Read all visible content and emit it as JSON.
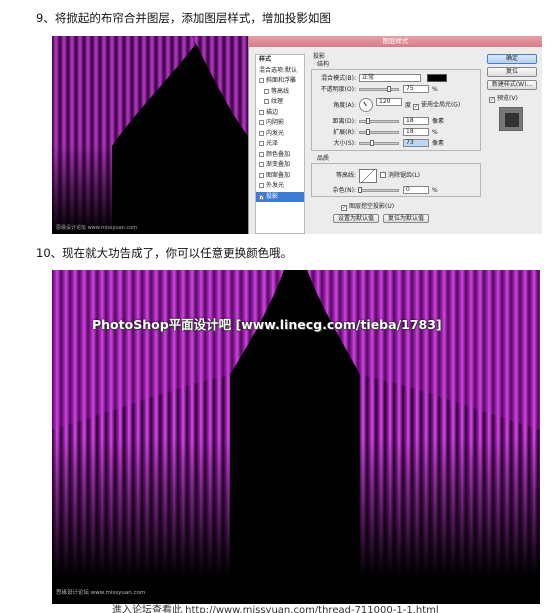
{
  "step9": {
    "text": "9、将掀起的布帘合并图层，添加图层样式，增加投影如图"
  },
  "step10": {
    "text": "10、现在就大功告成了，你可以任意更换颜色哦。"
  },
  "dialog": {
    "title": "图层样式",
    "styles_header": "样式",
    "blend_default": "混合选项:默认",
    "items": [
      {
        "label": "斜面和浮雕",
        "checked": false,
        "sub": false
      },
      {
        "label": "等高线",
        "checked": false,
        "sub": true
      },
      {
        "label": "纹理",
        "checked": false,
        "sub": true
      },
      {
        "label": "描边",
        "checked": false,
        "sub": false
      },
      {
        "label": "内阴影",
        "checked": false,
        "sub": false
      },
      {
        "label": "内发光",
        "checked": false,
        "sub": false
      },
      {
        "label": "光泽",
        "checked": false,
        "sub": false
      },
      {
        "label": "颜色叠加",
        "checked": false,
        "sub": false
      },
      {
        "label": "渐变叠加",
        "checked": false,
        "sub": false
      },
      {
        "label": "图案叠加",
        "checked": false,
        "sub": false
      },
      {
        "label": "外发光",
        "checked": false,
        "sub": false
      },
      {
        "label": "投影",
        "checked": true,
        "sub": false,
        "selected": true
      }
    ],
    "section_title": "投影",
    "structure_title": "结构",
    "blend_mode_label": "混合模式(B):",
    "blend_mode_value": "正常",
    "opacity_label": "不透明度(O):",
    "opacity_value": "75",
    "opacity_pct": 75,
    "angle_label": "角度(A):",
    "angle_value": "120",
    "angle_unit": "度",
    "global_light_label": "使用全局光(G)",
    "distance_label": "距离(D):",
    "distance_value": "18",
    "spread_label": "扩展(R):",
    "spread_value": "18",
    "size_label": "大小(S):",
    "size_value": "73",
    "unit_px": "像素",
    "unit_pct": "%",
    "quality_title": "品质",
    "contour_label": "等高线:",
    "antialias_label": "消除锯齿(L)",
    "noise_label": "杂色(N):",
    "noise_value": "0",
    "knockout_label": "图层挖空投影(U)",
    "set_default": "设置为默认值",
    "reset_default": "复位为默认值",
    "ok": "确定",
    "cancel": "复位",
    "new_style": "新建样式(W)...",
    "preview": "预览(V)"
  },
  "watermark_small": "思缘设计论坛 www.missyuan.com",
  "watermark_big": "PhotoShop平面设计吧 [www.linecg.com/tieba/1783]",
  "source_line": "進入论坛查看此 http://www.missyuan.com/thread-711000-1-1.html",
  "colors": {
    "curtain": "#a012b4",
    "curtain_light": "#e24ef0",
    "bg": "#000000"
  }
}
